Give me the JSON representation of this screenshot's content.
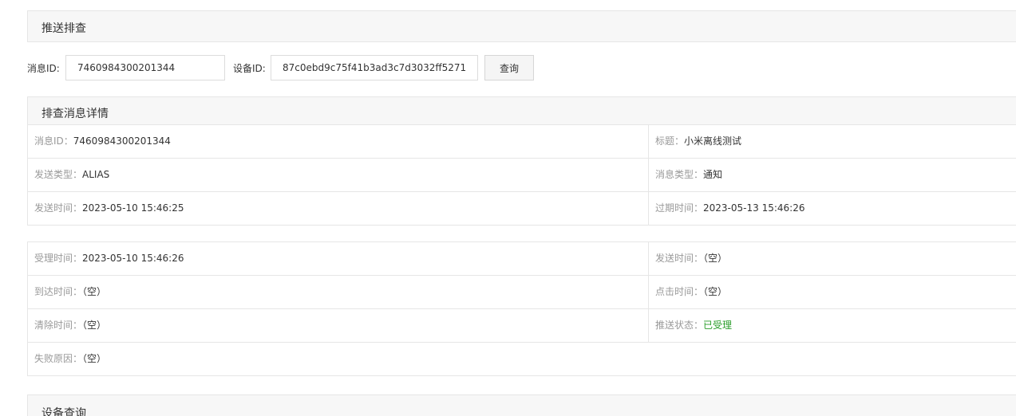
{
  "push_check": {
    "title": "推送排查",
    "msg_id_label": "消息ID:",
    "msg_id_value": "7460984300201344",
    "device_id_label": "设备ID:",
    "device_id_value": "87c0ebd9c75f41b3ad3c7d3032ff5271",
    "query_button": "查询"
  },
  "details": {
    "title": "排查消息详情",
    "rows1": [
      {
        "left_label": "消息ID：",
        "left_value": "7460984300201344",
        "right_label": "标题：",
        "right_value": "小米离线测试"
      },
      {
        "left_label": "发送类型：",
        "left_value": "ALIAS",
        "right_label": "消息类型：",
        "right_value": "通知"
      },
      {
        "left_label": "发送时间：",
        "left_value": "2023-05-10 15:46:25",
        "right_label": "过期时间：",
        "right_value": "2023-05-13 15:46:26"
      }
    ],
    "rows2": [
      {
        "left_label": "受理时间：",
        "left_value": "2023-05-10 15:46:26",
        "right_label": "发送时间：",
        "right_value": "（空）"
      },
      {
        "left_label": "到达时间：",
        "left_value": "（空）",
        "right_label": "点击时间：",
        "right_value": "（空）"
      },
      {
        "left_label": "清除时间：",
        "left_value": "（空）",
        "right_label": "推送状态：",
        "right_value": "已受理"
      }
    ],
    "fail_label": "失败原因：",
    "fail_value": "（空）",
    "status_color": "#2a9d2a"
  },
  "device_query": {
    "title": "设备查询"
  }
}
